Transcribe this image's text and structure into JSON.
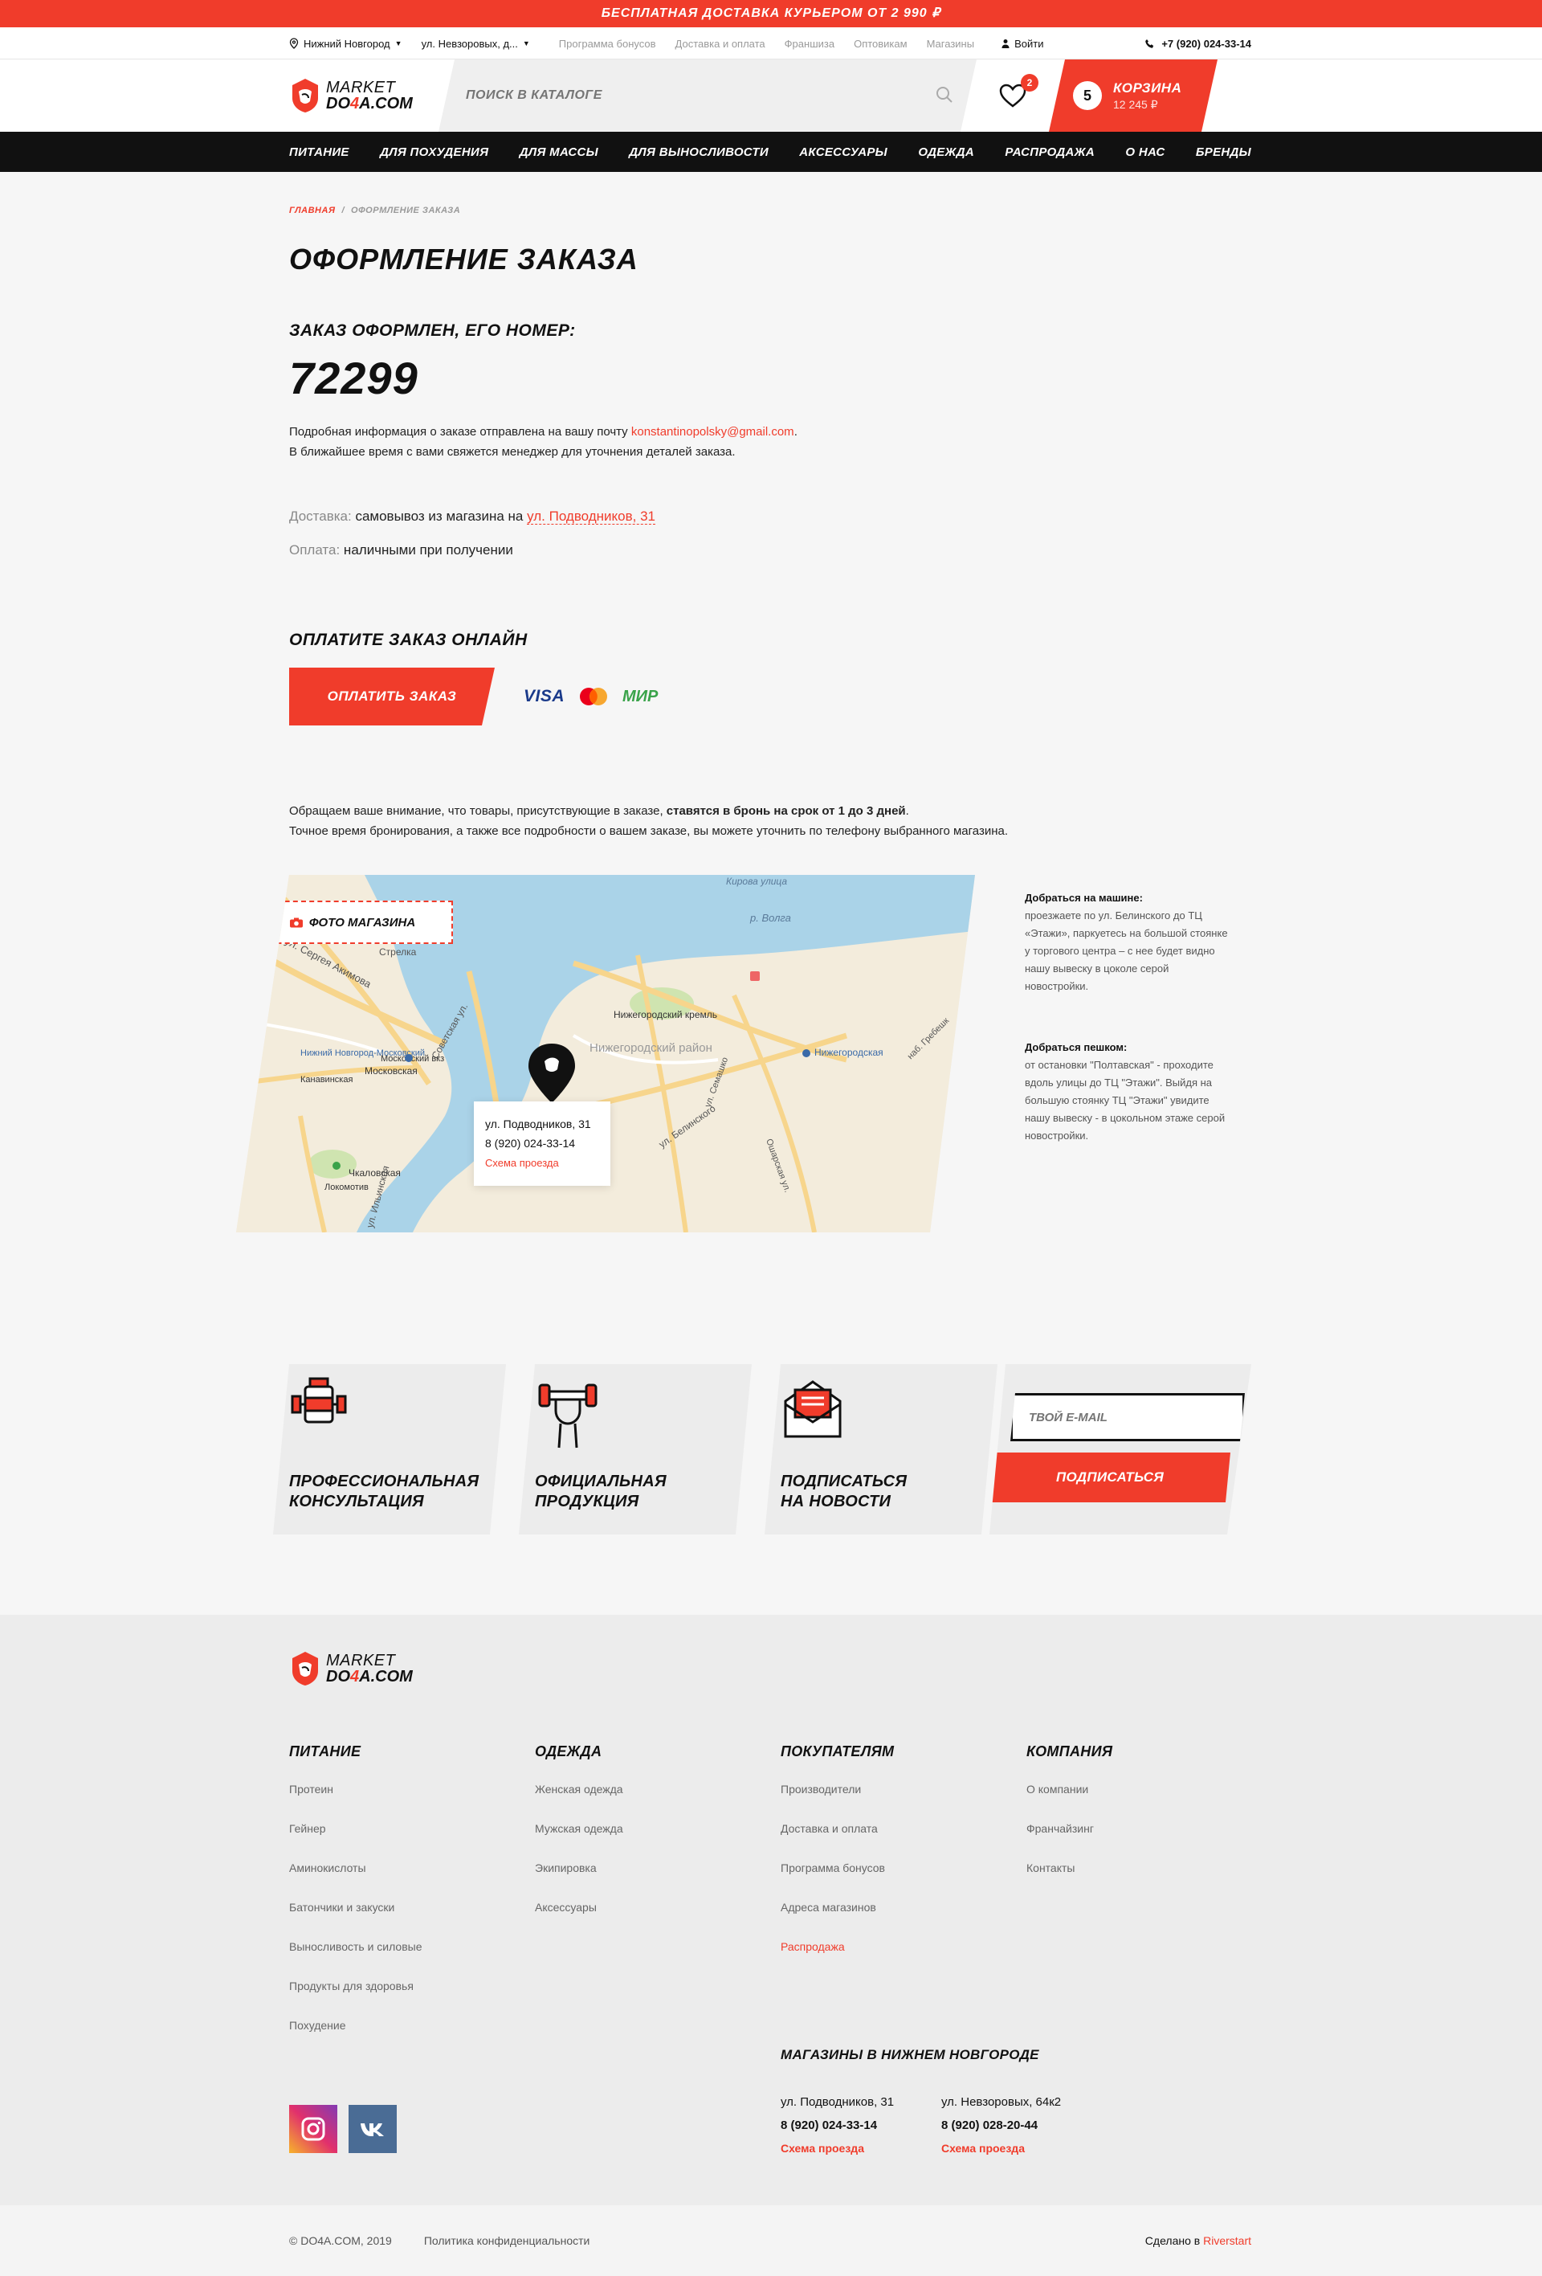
{
  "promo": "БЕСПЛАТНАЯ ДОСТАВКА КУРЬЕРОМ ОТ 2 990 ₽",
  "util": {
    "city": "Нижний Новгород",
    "address": "ул. Невзоровых, д...",
    "links": [
      "Программа бонусов",
      "Доставка и оплата",
      "Франшиза",
      "Оптовикам",
      "Магазины"
    ],
    "login": "Войти",
    "phone": "+7 (920) 024-33-14"
  },
  "logo": {
    "line1": "MARKET",
    "line2a": "DO",
    "line2b": "4",
    "line2c": "A.COM"
  },
  "search": {
    "placeholder": "ПОИСК В КАТАЛОГЕ"
  },
  "favorites": {
    "count": "2"
  },
  "cart": {
    "count": "5",
    "label": "КОРЗИНА",
    "total": "12 245 ₽"
  },
  "nav": [
    "ПИТАНИЕ",
    "ДЛЯ ПОХУДЕНИЯ",
    "ДЛЯ МАССЫ",
    "ДЛЯ ВЫНОСЛИВОСТИ",
    "АКСЕССУАРЫ",
    "ОДЕЖДА",
    "РАСПРОДАЖА",
    "О НАС",
    "БРЕНДЫ"
  ],
  "breadcrumb": {
    "home": "ГЛАВНАЯ",
    "sep": "/",
    "current": "ОФОРМЛЕНИЕ ЗАКАЗА"
  },
  "page_title": "ОФОРМЛЕНИЕ ЗАКАЗА",
  "order": {
    "label": "ЗАКАЗ ОФОРМЛЕН, ЕГО НОМЕР:",
    "number": "72299",
    "info1": "Подробная информация о заказе отправлена на вашу почту ",
    "email": "konstantinopolsky@gmail.com",
    "info1_end": ".",
    "info2": "В ближайшее время с вами свяжется менеджер для уточнения деталей заказа."
  },
  "delivery": {
    "key": "Доставка:",
    "value": " самовывоз из магазина на ",
    "address": "ул. Подводников, 31"
  },
  "payment": {
    "key": "Оплата:",
    "value": " наличными при получении"
  },
  "pay_online": {
    "title": "ОПЛАТИТЕ ЗАКАЗ ОНЛАЙН",
    "button": "ОПЛАТИТЬ ЗАКАЗ",
    "visa": "VISA",
    "mir": "МИР"
  },
  "notice": {
    "part1": "Обращаем ваше внимание, что товары, присутствующие в заказе, ",
    "bold": "ставятся в бронь на срок от 1 до 3 дней",
    "part1_end": ".",
    "line2": "Точное время бронирования, а также все подробности о вашем заказе, вы можете уточнить по телефону выбранного магазина."
  },
  "map": {
    "photo_button": "ФОТО МАГАЗИНА",
    "card": {
      "address": "ул. Подводников, 31",
      "phone": "8 (920) 024-33-14",
      "route": "Схема проезда"
    },
    "labels": [
      "Кирова улица",
      "р. Волга",
      "Стрелка",
      "ул. Сергея Акимова",
      "Советская ул.",
      "Нижегородский кремль",
      "Нижегородский район",
      "ул. Белинского",
      "Московская",
      "Московский вкз",
      "Нижегородская",
      "Канавинская",
      "Чкаловская",
      "Локомотив",
      "ул. Ильинская",
      "Нижний Новгород-Московский",
      "ул. Семашко",
      "наб. Гребешк",
      "Ошарская ул."
    ]
  },
  "howto": {
    "car_title": "Добраться на машине:",
    "car_text": "проезжаете по ул. Белинского до ТЦ «Этажи», паркуетесь на большой стоянке у торгового центра – с нее будет видно нашу вывеску в цоколе серой новостройки.",
    "walk_title": "Добраться пешком:",
    "walk_text": "от остановки \"Полтавская\" - проходите вдоль улицы до ТЦ \"Этажи\". Выйдя на большую стоянку ТЦ \"Этажи\" увидите нашу вывеску - в цокольном этаже серой новостройки."
  },
  "features": [
    {
      "line1": "ПРОФЕССИОНАЛЬНАЯ",
      "line2": "КОНСУЛЬТАЦИЯ"
    },
    {
      "line1": "ОФИЦИАЛЬНАЯ",
      "line2": "ПРОДУКЦИЯ"
    },
    {
      "line1": "ПОДПИСАТЬСЯ",
      "line2": "НА НОВОСТИ"
    }
  ],
  "subscribe": {
    "placeholder": "ТВОЙ E-MAIL",
    "button": "ПОДПИСАТЬСЯ"
  },
  "footer": {
    "columns": [
      {
        "title": "ПИТАНИЕ",
        "items": [
          "Протеин",
          "Гейнер",
          "Аминокислоты",
          "Батончики и закуски",
          "Выносливость и силовые",
          "Продукты для здоровья",
          "Похудение"
        ]
      },
      {
        "title": "ОДЕЖДА",
        "items": [
          "Женская одежда",
          "Мужская одежда",
          "Экипировка",
          "Аксессуары"
        ]
      },
      {
        "title": "ПОКУПАТЕЛЯМ",
        "items": [
          "Производители",
          "Доставка и оплата",
          "Программа бонусов",
          "Адреса магазинов",
          "Распродажа"
        ]
      },
      {
        "title": "КОМПАНИЯ",
        "items": [
          "О компании",
          "Франчайзинг",
          "Контакты"
        ]
      }
    ],
    "stores_title": "МАГАЗИНЫ В НИЖНЕМ НОВГОРОДЕ",
    "stores": [
      {
        "address": "ул. Подводников, 31",
        "phone": "8 (920) 024-33-14",
        "route": "Схема проезда"
      },
      {
        "address": "ул. Невзоровых, 64к2",
        "phone": "8 (920) 028-20-44",
        "route": "Схема проезда"
      }
    ],
    "copyright": "© DO4A.COM, 2019",
    "policy": "Политика конфиденциальности",
    "made_by": "Сделано в ",
    "made_by_link": "Riverstart"
  },
  "colors": {
    "accent": "#f03c2b",
    "dark": "#111111",
    "bg": "#f6f6f6"
  }
}
